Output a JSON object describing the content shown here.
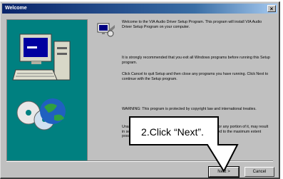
{
  "window": {
    "title": "Welcome",
    "close_glyph": "×"
  },
  "body": {
    "welcome": "Welcome to the VIA Audio Driver Setup Program. This program will install VIA Audio Driver Setup Program on your computer.",
    "exit_advice": "It is strongly recommended that you exit all Windows programs before running this Setup program.",
    "cancel_advice": "Click Cancel to quit Setup and then close any programs you have running. Click Next to continue with the Setup program.",
    "warning": "WARNING: This program is protected by copyright law and international treaties.",
    "unauthorized": "Unauthorized reproduction or distribution of this program, or any portion of it, may result in severe civil and criminal penalties, and will be prosecuted to the maximum extent possible under law."
  },
  "buttons": {
    "next": "Next >",
    "cancel": "Cancel"
  },
  "annotation": {
    "text": "2.Click “Next”."
  },
  "colors": {
    "titlebar": "#0a246a",
    "face": "#c0c0c0",
    "art_background": "#008080"
  }
}
